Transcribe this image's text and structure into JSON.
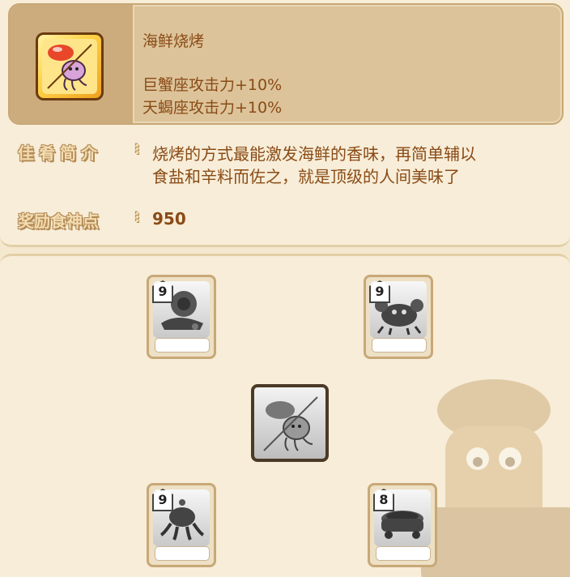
{
  "dish": {
    "name": "海鲜烧烤",
    "bonuses": [
      "巨蟹座攻击力+10%",
      "天蝎座攻击力+10%"
    ]
  },
  "intro": {
    "label": "佳肴简介",
    "lines": [
      "烧烤的方式最能激发海鲜的香味，再简单辅以",
      "食盐和辛料而佐之，就是顶级的人间美味了"
    ]
  },
  "reward": {
    "label": "奖励食神点",
    "value": "950"
  },
  "ingredients": [
    {
      "name": "snail-ingredient",
      "level": "9"
    },
    {
      "name": "crab-ingredient",
      "level": "9"
    },
    {
      "name": "octopus-ingredient",
      "level": "9"
    },
    {
      "name": "pot-ingredient",
      "level": "8"
    }
  ],
  "colors": {
    "text_brown": "#8a4b16",
    "label_fill": "#f3dcb0",
    "label_outline": "#b38a56",
    "panel_bg": "#f7edd8",
    "header_bg": "#dcc39a"
  }
}
